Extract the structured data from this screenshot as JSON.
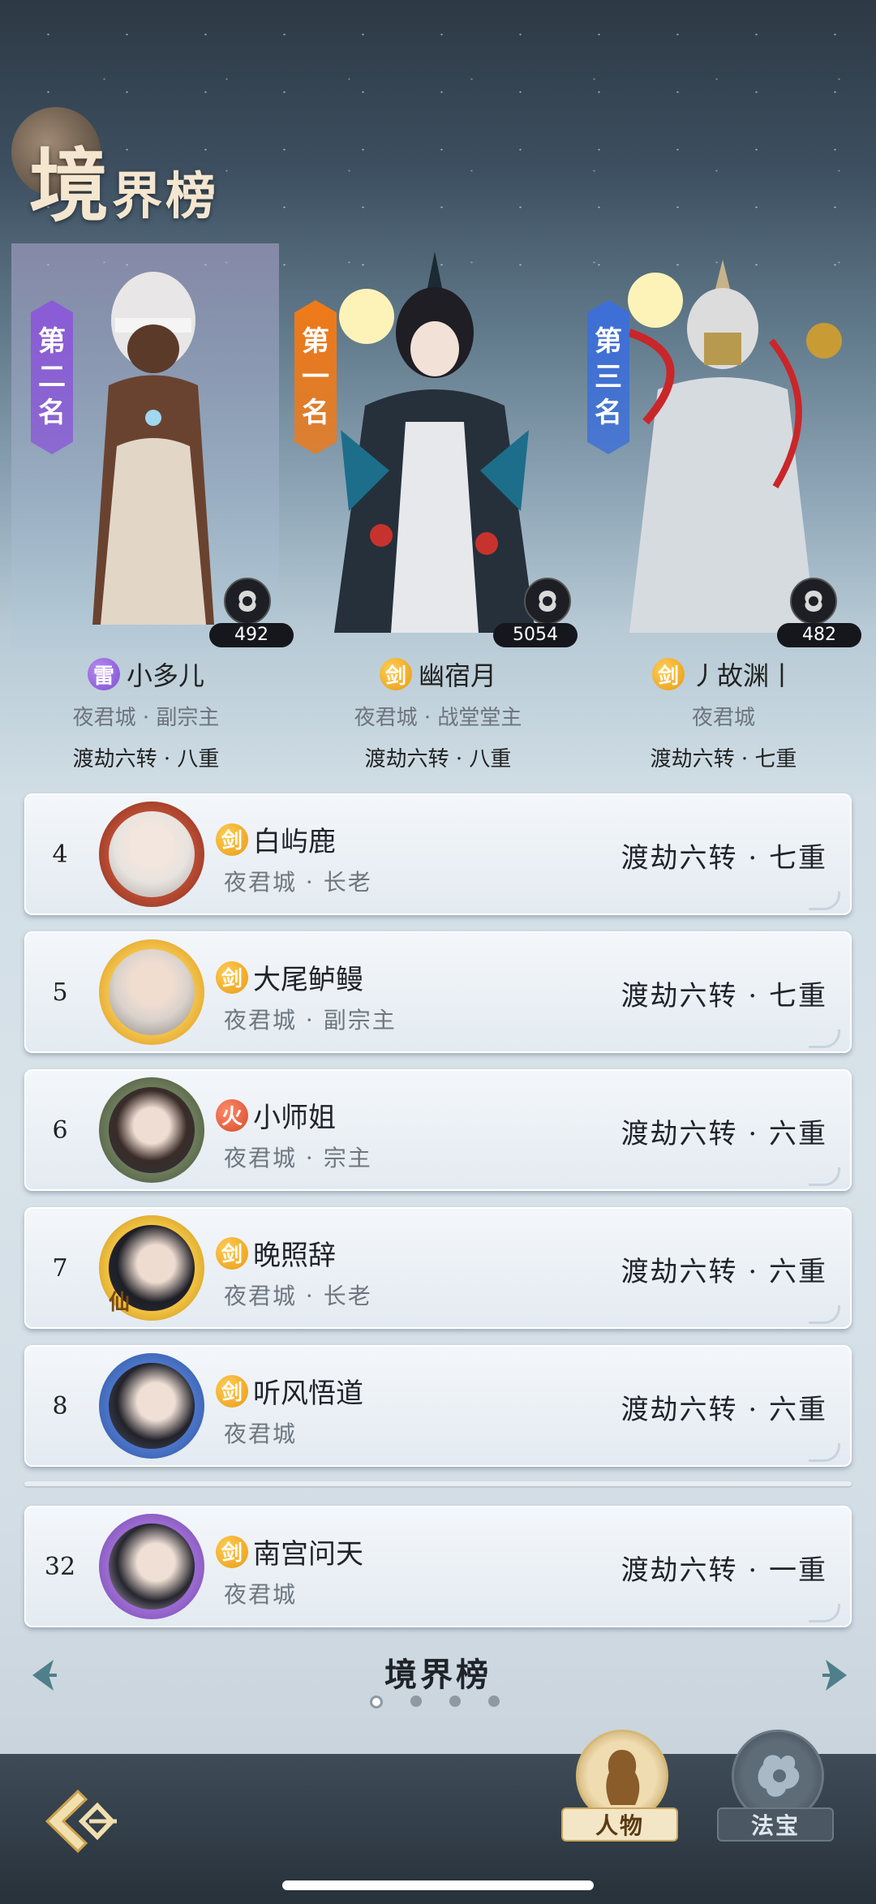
{
  "page": {
    "title": "境界榜",
    "footer_title": "境界榜"
  },
  "top_three": [
    {
      "rank_label": "第二名",
      "rank_chars": [
        "第",
        "二",
        "名"
      ],
      "element": "雷",
      "name": "小多儿",
      "sect": "夜君城 · 副宗主",
      "realm": "渡劫六转 · 八重",
      "score": "492",
      "banner_color": "#8a5bd6"
    },
    {
      "rank_label": "第一名",
      "rank_chars": [
        "第",
        "一",
        "名"
      ],
      "element": "剑",
      "name": "幽宿月",
      "sect": "夜君城 · 战堂堂主",
      "realm": "渡劫六转 · 八重",
      "score": "5054",
      "banner_color": "#f07a18"
    },
    {
      "rank_label": "第三名",
      "rank_chars": [
        "第",
        "三",
        "名"
      ],
      "element": "剑",
      "name": "丿故渊丨",
      "sect": "夜君城",
      "realm": "渡劫六转 · 七重",
      "score": "482",
      "banner_color": "#3d6fd8"
    }
  ],
  "rows": [
    {
      "rank": "4",
      "element": "剑",
      "name": "白屿鹿",
      "sect": "夜君城 · 长老",
      "realm": "渡劫六转 · 七重"
    },
    {
      "rank": "5",
      "element": "剑",
      "name": "大尾鲈鳗",
      "sect": "夜君城 · 副宗主",
      "realm": "渡劫六转 · 七重"
    },
    {
      "rank": "6",
      "element": "火",
      "name": "小师姐",
      "sect": "夜君城 · 宗主",
      "realm": "渡劫六转 · 六重"
    },
    {
      "rank": "7",
      "element": "剑",
      "name": "晚照辞",
      "sect": "夜君城 · 长老",
      "realm": "渡劫六转 · 六重"
    },
    {
      "rank": "8",
      "element": "剑",
      "name": "听风悟道",
      "sect": "夜君城",
      "realm": "渡劫六转 · 六重"
    }
  ],
  "my_row": {
    "rank": "32",
    "element": "剑",
    "name": "南宫问天",
    "sect": "夜君城",
    "realm": "渡劫六转 · 一重"
  },
  "avatar_badges": {
    "row7": "仙"
  },
  "pagination": {
    "total": 4,
    "active": 1
  },
  "tabs": [
    {
      "label": "人物",
      "icon": "character-icon",
      "active": true
    },
    {
      "label": "法宝",
      "icon": "treasure-icon",
      "active": false
    }
  ],
  "icons": {
    "back": "back-arrow-icon",
    "prev": "chevron-left-icon",
    "next": "chevron-right-icon",
    "emblem": "sect-emblem-icon"
  },
  "colors": {
    "sword": "#f0a21c",
    "thunder": "#8a5bd6",
    "fire": "#d44a28",
    "title": "#f4e6cf"
  }
}
